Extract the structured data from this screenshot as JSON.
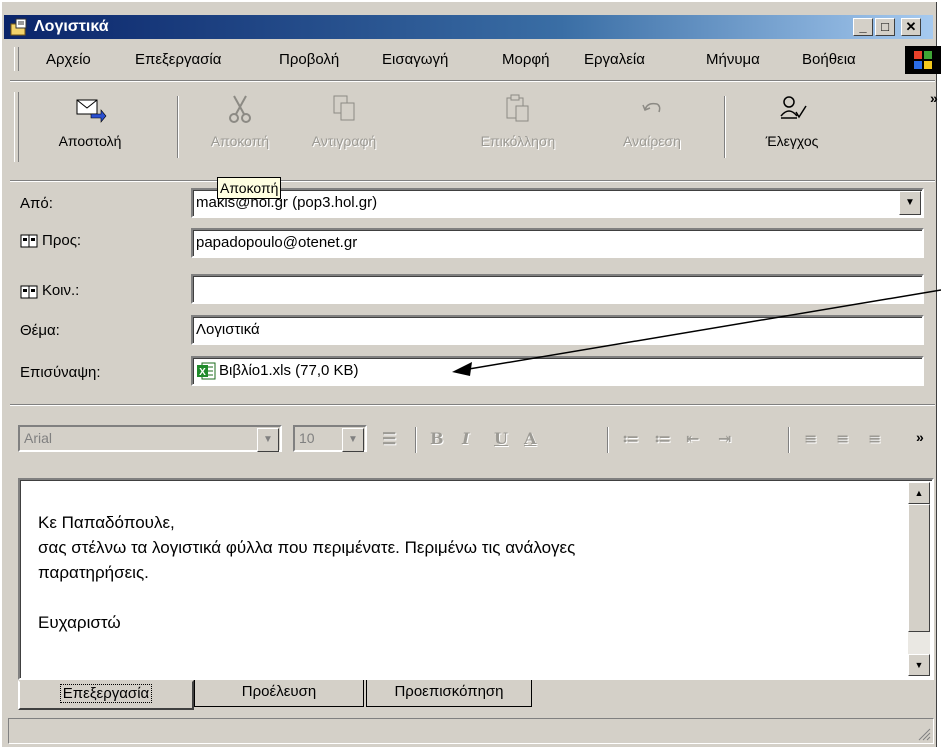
{
  "window": {
    "title": "Λογιστικά"
  },
  "menu": [
    "Αρχείο",
    "Επεξεργασία",
    "Προβολή",
    "Εισαγωγή",
    "Μορφή",
    "Εργαλεία",
    "Μήνυμα",
    "Βοήθεια"
  ],
  "toolbar": {
    "send": "Αποστολή",
    "cut": "Αποκοπή",
    "copy": "Αντιγραφή",
    "paste": "Επικόλληση",
    "undo": "Αναίρεση",
    "check": "Έλεγχος",
    "more": "»"
  },
  "tooltip": "Αποκοπή",
  "header": {
    "from_label": "Από:",
    "from_value": "makis@hol.gr    (pop3.hol.gr)",
    "to_label": "Προς:",
    "to_value": "papadopoulo@otenet.gr",
    "cc_label": "Κοιν.:",
    "cc_value": "",
    "subject_label": "Θέμα:",
    "subject_value": "Λογιστικά",
    "attach_label": "Επισύναψη:",
    "attach_value": "Βιβλίο1.xls (77,0 KB)"
  },
  "format": {
    "font": "Arial",
    "size": "10",
    "bold": "B",
    "italic": "I",
    "underline": "U",
    "more": "»"
  },
  "body": {
    "line1": "Κε Παπαδόπουλε,",
    "line2": "σας στέλνω τα λογιστικά φύλλα που περιμένατε. Περιμένω τις ανάλογες",
    "line3": "παρατηρήσεις.",
    "line4": "",
    "line5": "Ευχαριστώ"
  },
  "tabs": [
    "Επεξεργασία",
    "Προέλευση",
    "Προεπισκόπηση"
  ]
}
